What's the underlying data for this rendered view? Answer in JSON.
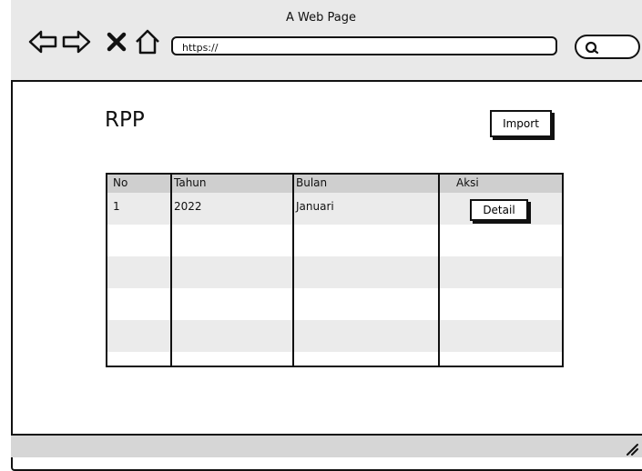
{
  "browser": {
    "title": "A Web Page",
    "url": "https://",
    "icons": [
      "back-arrow-icon",
      "forward-arrow-icon",
      "close-x-icon",
      "home-icon",
      "search-icon"
    ]
  },
  "page": {
    "heading": "RPP",
    "import_label": "Import"
  },
  "table": {
    "columns": [
      "No",
      "Tahun",
      "Bulan",
      "Aksi"
    ],
    "rows": [
      {
        "no": "1",
        "tahun": "2022",
        "bulan": "Januari",
        "action_label": "Detail"
      }
    ]
  },
  "colors": {
    "chrome": "#e9e9e9",
    "header_row": "#cfcfcf",
    "shaded_row": "#ebebeb",
    "ink": "#111111"
  }
}
